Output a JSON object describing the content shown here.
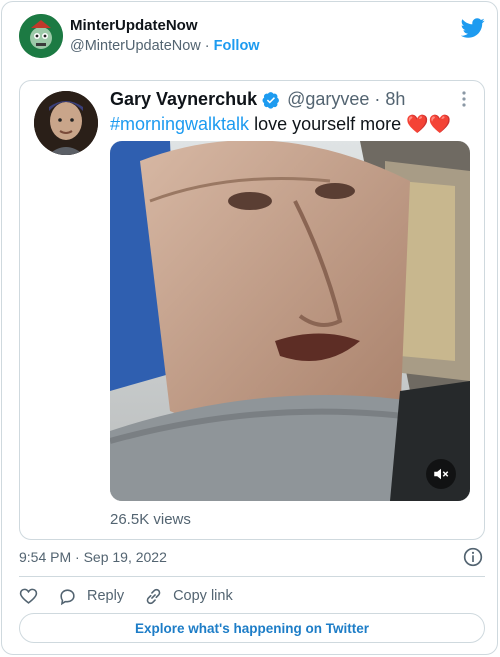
{
  "embed": {
    "author": {
      "name": "MinterUpdateNow",
      "handle": "@MinterUpdateNow",
      "separator": " · ",
      "follow_label": "Follow"
    },
    "quoted": {
      "name": "Gary Vaynerchuk",
      "handle": "@garyvee",
      "dot": " · ",
      "time": "8h",
      "hashtag": "#morningwalktalk",
      "text": " love yourself more ",
      "hearts": "❤️❤️",
      "views": "26.5K views"
    },
    "timestamp": "9:54 PM · Sep 19, 2022",
    "actions": {
      "reply_label": "Reply",
      "copy_label": "Copy link"
    },
    "explore_label": "Explore what's happening on Twitter",
    "colors": {
      "accent": "#1d9bf0",
      "secondary_text": "#536471",
      "border": "#cfd9de",
      "heart": "#e0245e"
    },
    "icons": [
      "twitter-logo-icon",
      "verified-badge-icon",
      "more-icon",
      "mute-icon",
      "info-icon",
      "heart-icon",
      "reply-icon",
      "copy-link-icon"
    ]
  }
}
